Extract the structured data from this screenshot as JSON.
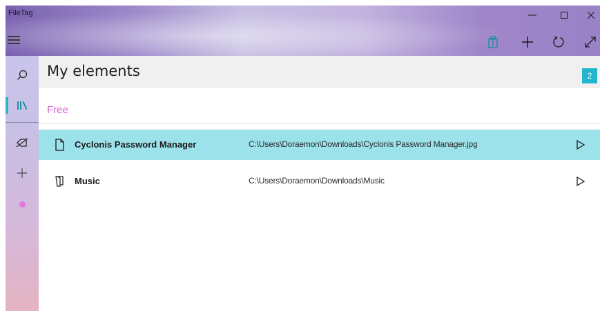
{
  "window": {
    "title": "FileTag",
    "controls": {
      "minimize": "–",
      "maximize": "☐",
      "close": "✕"
    }
  },
  "toolbar": {
    "items": [
      {
        "name": "clipboard-icon"
      },
      {
        "name": "add-icon"
      },
      {
        "name": "refresh-icon"
      },
      {
        "name": "expand-icon"
      }
    ]
  },
  "sidebar": {
    "items": [
      {
        "name": "search-icon"
      },
      {
        "name": "library-icon",
        "active": true
      },
      {
        "name": "tag-off-icon"
      },
      {
        "name": "add-icon"
      },
      {
        "name": "tag-dot",
        "color": "#e277e0"
      }
    ]
  },
  "main": {
    "title": "My elements",
    "count": "2",
    "group_label": "Free",
    "rows": [
      {
        "icon": "file-icon",
        "name": "Cyclonis Password Manager",
        "path": "C:\\Users\\Doraemon\\Downloads\\Cyclonis Password Manager.jpg",
        "selected": true
      },
      {
        "icon": "folder-icon",
        "name": "Music",
        "path": "C:\\Users\\Doraemon\\Downloads\\Music",
        "selected": false
      }
    ]
  },
  "colors": {
    "accent": "#22b6cd",
    "selection": "#9ce2ea",
    "group_label": "#d561d6"
  }
}
